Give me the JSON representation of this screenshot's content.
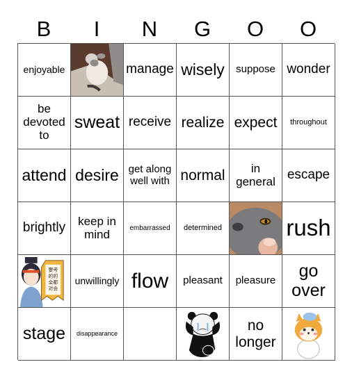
{
  "header": [
    "B",
    "I",
    "N",
    "G",
    "O",
    "O"
  ],
  "cells": [
    {
      "text": "enjoyable"
    },
    {
      "image": "cat-lounging-image"
    },
    {
      "text": "manage"
    },
    {
      "text": "wisely"
    },
    {
      "text": "suppose"
    },
    {
      "text": "wonder"
    },
    {
      "text": "be devoted to"
    },
    {
      "text": "sweat"
    },
    {
      "text": "receive"
    },
    {
      "text": "realize"
    },
    {
      "text": "expect"
    },
    {
      "text": "throughout"
    },
    {
      "text": "attend"
    },
    {
      "text": "desire"
    },
    {
      "text": "get along well with"
    },
    {
      "text": "normal"
    },
    {
      "text": "in general"
    },
    {
      "text": "escape"
    },
    {
      "text": "brightly"
    },
    {
      "text": "keep in mind"
    },
    {
      "text": "embarrassed"
    },
    {
      "text": "determined"
    },
    {
      "image": "gray-cat-closeup-image"
    },
    {
      "text": "rush"
    },
    {
      "image": "cartoon-student-sign-image",
      "sign_text": "要考的的全都对会"
    },
    {
      "text": "unwillingly"
    },
    {
      "text": "flow"
    },
    {
      "text": "pleasant"
    },
    {
      "text": "pleasure"
    },
    {
      "text": "go over"
    },
    {
      "text": "stage"
    },
    {
      "text": "disappearance"
    },
    {
      "text": ""
    },
    {
      "image": "crying-panda-meme-image"
    },
    {
      "text": "no longer"
    },
    {
      "image": "shiba-dog-sticker-image"
    }
  ]
}
